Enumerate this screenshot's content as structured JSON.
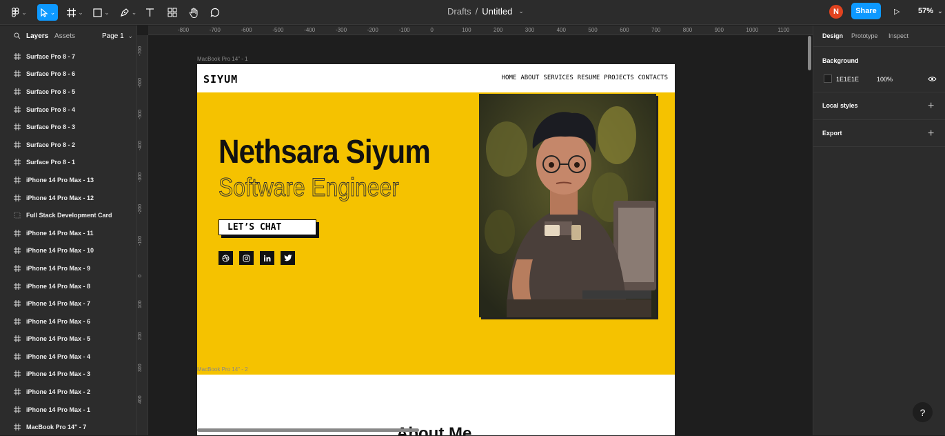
{
  "toolbar": {
    "file_location": "Drafts",
    "separator": "/",
    "file_name": "Untitled",
    "avatar_initial": "N",
    "share_label": "Share",
    "zoom": "57%"
  },
  "left_panel": {
    "tab_layers": "Layers",
    "tab_assets": "Assets",
    "page_label": "Page 1",
    "layers": [
      {
        "name": "Surface Pro 8 - 7",
        "kind": "frame"
      },
      {
        "name": "Surface Pro 8 - 6",
        "kind": "frame"
      },
      {
        "name": "Surface Pro 8 - 5",
        "kind": "frame"
      },
      {
        "name": "Surface Pro 8 - 4",
        "kind": "frame"
      },
      {
        "name": "Surface Pro 8 - 3",
        "kind": "frame"
      },
      {
        "name": "Surface Pro 8 - 2",
        "kind": "frame"
      },
      {
        "name": "Surface Pro 8 - 1",
        "kind": "frame"
      },
      {
        "name": "iPhone 14 Pro Max - 13",
        "kind": "frame"
      },
      {
        "name": "iPhone 14 Pro Max - 12",
        "kind": "frame"
      },
      {
        "name": "Full Stack Development Card",
        "kind": "group"
      },
      {
        "name": "iPhone 14 Pro Max - 11",
        "kind": "frame"
      },
      {
        "name": "iPhone 14 Pro Max - 10",
        "kind": "frame"
      },
      {
        "name": "iPhone 14 Pro Max - 9",
        "kind": "frame"
      },
      {
        "name": "iPhone 14 Pro Max - 8",
        "kind": "frame"
      },
      {
        "name": "iPhone 14 Pro Max - 7",
        "kind": "frame"
      },
      {
        "name": "iPhone 14 Pro Max - 6",
        "kind": "frame"
      },
      {
        "name": "iPhone 14 Pro Max - 5",
        "kind": "frame"
      },
      {
        "name": "iPhone 14 Pro Max - 4",
        "kind": "frame"
      },
      {
        "name": "iPhone 14 Pro Max - 3",
        "kind": "frame"
      },
      {
        "name": "iPhone 14 Pro Max - 2",
        "kind": "frame"
      },
      {
        "name": "iPhone 14 Pro Max - 1",
        "kind": "frame"
      },
      {
        "name": "MacBook Pro 14\" - 7",
        "kind": "frame"
      }
    ]
  },
  "rulers": {
    "top": [
      "-800",
      "-700",
      "-600",
      "-500",
      "-400",
      "-300",
      "-200",
      "-100",
      "0",
      "100",
      "200",
      "300",
      "400",
      "500",
      "600",
      "700",
      "800",
      "900",
      "1000",
      "1100"
    ],
    "left": [
      "-700",
      "-600",
      "-500",
      "-400",
      "-300",
      "-200",
      "-100",
      "0",
      "100",
      "200",
      "300",
      "400"
    ]
  },
  "canvas": {
    "frame1_label": "MacBook Pro 14\" - 1",
    "frame2_label": "MacBook Pro 14\" - 2",
    "site": {
      "logo": "SIYUM",
      "nav": [
        "HOME",
        "ABOUT",
        "SERVICES",
        "RESUME",
        "PROJECTS",
        "CONTACTS"
      ],
      "name": "Nethsara Siyum",
      "role": "Software Engineer",
      "cta": "LET’S CHAT",
      "socials": [
        "dribbble-icon",
        "instagram-icon",
        "linkedin-icon",
        "twitter-icon"
      ],
      "about_heading": "About Me",
      "accent": "#f5c200"
    }
  },
  "right_panel": {
    "tab_design": "Design",
    "tab_prototype": "Prototype",
    "tab_inspect": "Inspect",
    "background_title": "Background",
    "bg_hex": "1E1E1E",
    "bg_opacity": "100%",
    "local_styles": "Local styles",
    "export": "Export"
  },
  "help_label": "?"
}
